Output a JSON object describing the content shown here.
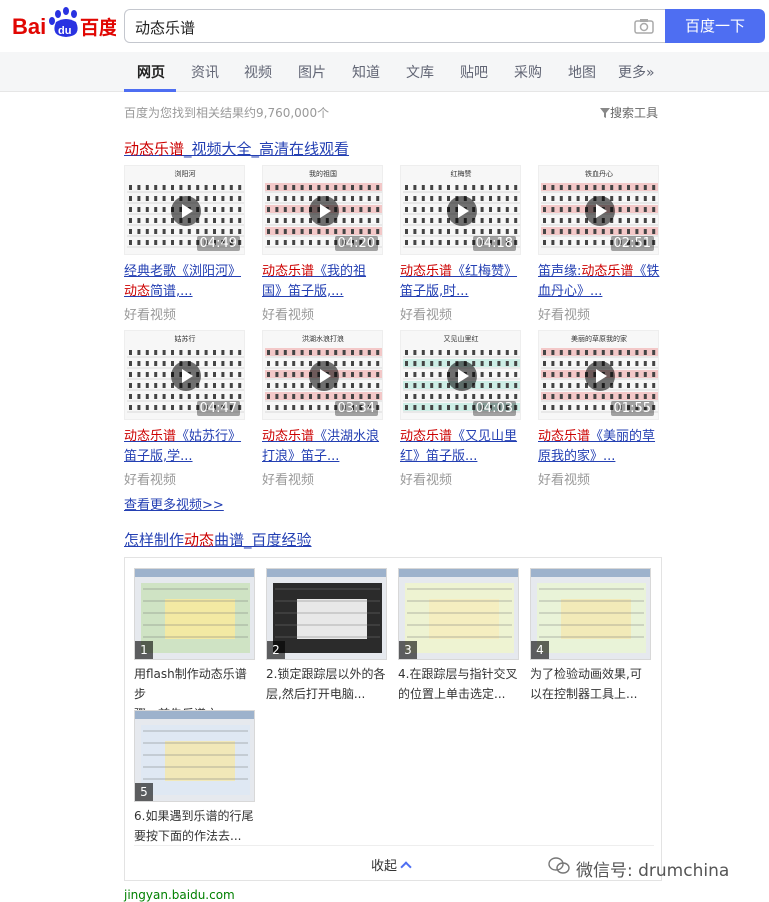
{
  "logo_text": {
    "bai": "Bai",
    "du": "du",
    "baidu_cn": "百度"
  },
  "search": {
    "query": "动态乐谱",
    "button_label": "百度一下"
  },
  "tabs": [
    "网页",
    "资讯",
    "视频",
    "图片",
    "知道",
    "文库",
    "贴吧",
    "采购",
    "地图",
    "更多»"
  ],
  "stats": "百度为您找到相关结果约9,760,000个",
  "search_tools": "搜索工具",
  "video_result": {
    "title_hl": "动态乐谱",
    "title_rest": "_视频大全_高清在线观看",
    "videos": [
      {
        "duration": "04:49",
        "line1": "经典老歌《浏阳河》",
        "line2_hl": "动态",
        "line2": "简谱,...",
        "source": "好看视频"
      },
      {
        "duration": "04:20",
        "line1_hl": "动态乐谱",
        "line1": "《我的祖",
        "line2": "国》笛子版,...",
        "source": "好看视频"
      },
      {
        "duration": "04:18",
        "line1_hl": "动态乐谱",
        "line1": "《红梅赞》",
        "line2": "笛子版,时...",
        "source": "好看视频"
      },
      {
        "duration": "02:51",
        "line1_pre": "笛声缘:",
        "line1_hl": "动态乐谱",
        "line1": "《铁",
        "line2": "血丹心》...",
        "source": "好看视频"
      },
      {
        "duration": "04:47",
        "line1_hl": "动态乐谱",
        "line1": "《姑苏行》",
        "line2": "笛子版,学...",
        "source": "好看视频"
      },
      {
        "duration": "03:34",
        "line1_hl": "动态乐谱",
        "line1": "《洪湖水浪",
        "line2": "打浪》笛子...",
        "source": "好看视频"
      },
      {
        "duration": "04:03",
        "line1_hl": "动态乐谱",
        "line1": "《又见山里",
        "line2": "红》笛子版...",
        "source": "好看视频"
      },
      {
        "duration": "01:55",
        "line1_hl": "动态乐谱",
        "line1": "《美丽的草",
        "line2": "原我的家》...",
        "source": "好看视频"
      }
    ],
    "thumb_titles": [
      "浏阳河",
      "我的祖国",
      "红梅赞",
      "铁血丹心",
      "姑苏行",
      "洪湖水浪打浪",
      "又见山里红",
      "美丽的草原我的家"
    ],
    "more_videos": "查看更多视频>>"
  },
  "jingyan": {
    "title_pre": "怎样制作",
    "title_hl": "动态",
    "title_rest": "曲谱_百度经验",
    "steps": [
      {
        "num": "1",
        "line1": "用flash制作动态乐谱步",
        "line2": "骤。首先乐谱之..."
      },
      {
        "num": "2",
        "line1": "2.锁定跟踪层以外的各",
        "line2": "层,然后打开电脑..."
      },
      {
        "num": "3",
        "line1": "4.在跟踪层与指针交叉",
        "line2": "的位置上单击选定..."
      },
      {
        "num": "4",
        "line1": "为了检验动画效果,可",
        "line2": "以在控制器工具上..."
      },
      {
        "num": "5",
        "line1": "6.如果遇到乐谱的行尾",
        "line2": "要按下面的作法去..."
      }
    ],
    "collapse": "收起",
    "url": "jingyan.baidu.com"
  },
  "watermark": "微信号: drumchina",
  "colors": {
    "accent": "#4e6ef2",
    "link": "#2440b3",
    "highlight": "#cc0000",
    "url_green": "#008000"
  }
}
